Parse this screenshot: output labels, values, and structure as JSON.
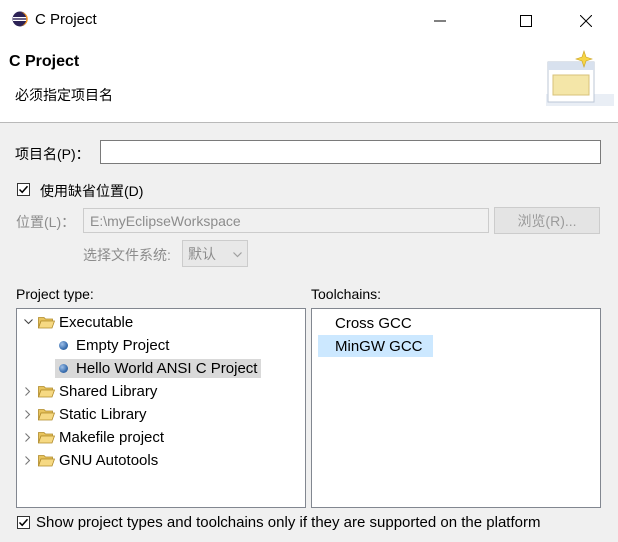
{
  "window": {
    "title": "C Project"
  },
  "banner": {
    "title": "C Project",
    "message": "必须指定项目名"
  },
  "form": {
    "project_name_label": "项目名(P)：",
    "project_name_value": "",
    "use_default_location_label": "使用缺省位置(D)",
    "use_default_location_checked": true,
    "location_label": "位置(L)：",
    "location_value": "E:\\myEclipseWorkspace",
    "browse_label": "浏览(R)...",
    "filesystem_label": "选择文件系统:",
    "filesystem_value": "默认"
  },
  "project_type": {
    "label": "Project type:",
    "items": [
      {
        "label": "Executable",
        "expanded": true
      },
      {
        "label": "Empty Project"
      },
      {
        "label": "Hello World ANSI C Project",
        "selected": true
      },
      {
        "label": "Shared Library",
        "expanded": false
      },
      {
        "label": "Static Library",
        "expanded": false
      },
      {
        "label": "Makefile project",
        "expanded": false
      },
      {
        "label": "GNU Autotools",
        "expanded": false
      }
    ]
  },
  "toolchains": {
    "label": "Toolchains:",
    "items": [
      {
        "label": "Cross GCC"
      },
      {
        "label": "MinGW GCC",
        "selected": true
      }
    ]
  },
  "footer": {
    "show_supported_label": "Show project types and toolchains only if they are supported on the platform",
    "show_supported_checked": true
  },
  "colors": {
    "selection_blue": "#cce8ff",
    "selection_gray": "#d9d9d9",
    "dialog_bg": "#f0f0f0"
  }
}
